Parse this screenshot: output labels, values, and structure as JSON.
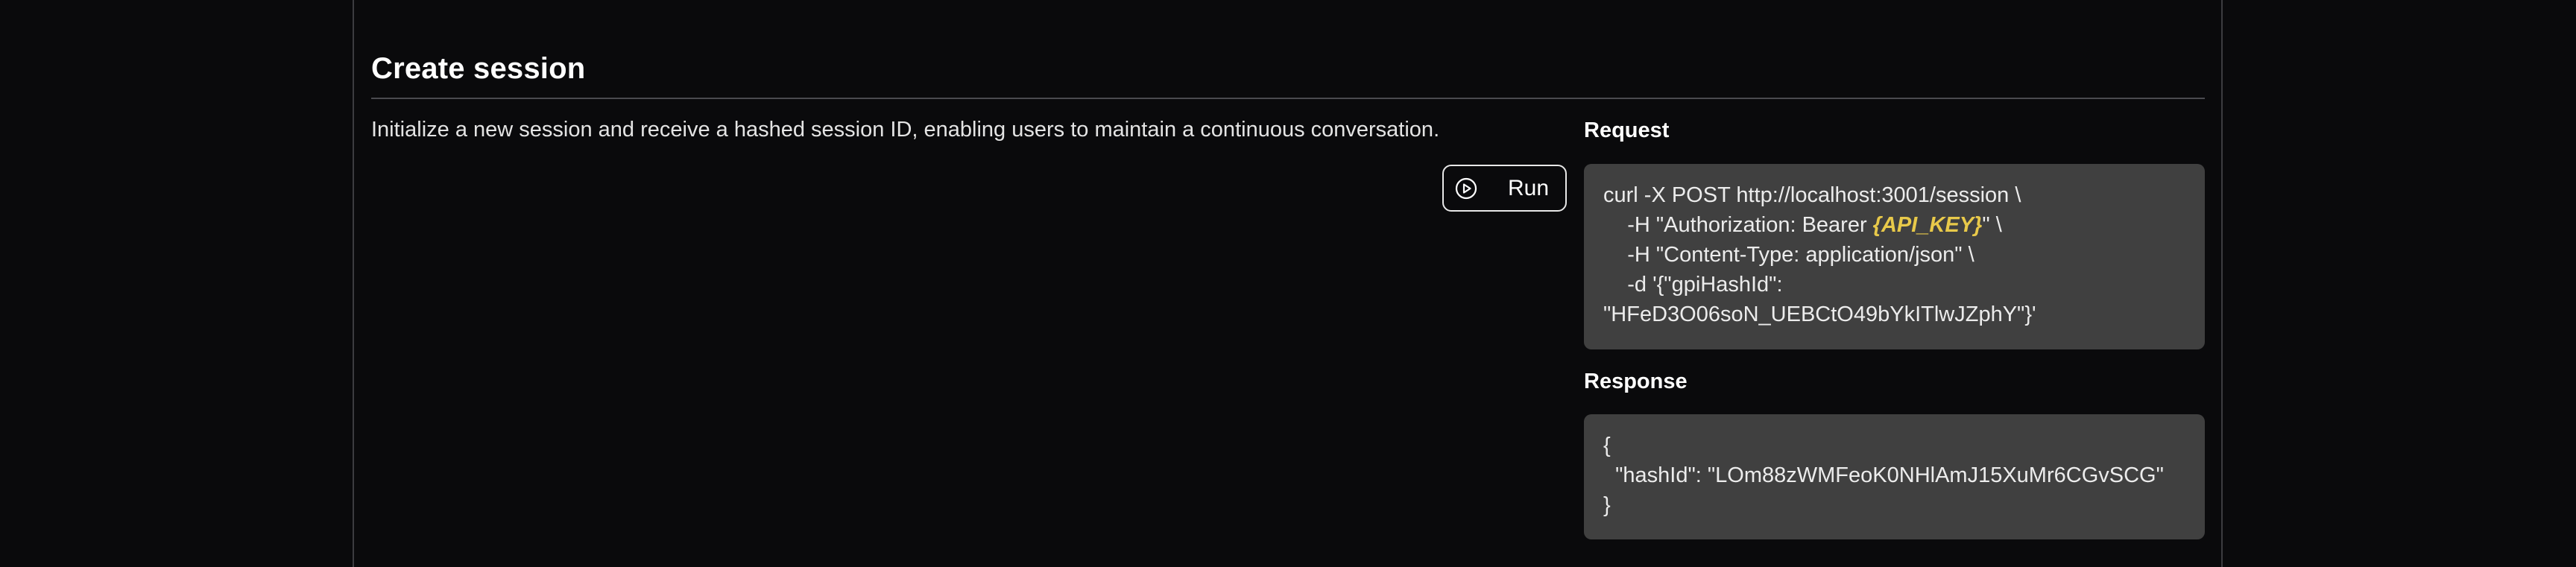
{
  "section": {
    "title": "Create session",
    "description": "Initialize a new session and receive a hashed session ID, enabling users to maintain a continuous conversation."
  },
  "run_button": {
    "label": "Run",
    "icon": "play-circle-icon"
  },
  "request": {
    "heading": "Request",
    "lines": {
      "l1": "curl -X POST http://localhost:3001/session \\",
      "l2_prefix": "    -H \"Authorization: Bearer ",
      "l2_key": "{API_KEY}",
      "l2_suffix": "\" \\",
      "l3": "    -H \"Content-Type: application/json\" \\",
      "l4": "    -d '{\"gpiHashId\":",
      "l5": "\"HFeD3O06soN_UEBCtO49bYkITlwJZphY\"}'"
    },
    "key_color": "#e8c94a"
  },
  "response": {
    "heading": "Response",
    "lines": {
      "l1": "{",
      "l2": "  \"hashId\": \"LOm88zWMFeoK0NHlAmJ15XuMr6CGvSCG\"",
      "l3": "}"
    }
  },
  "colors": {
    "background": "#0a0a0c",
    "code_background": "#404040",
    "divider": "#4a4a4f"
  }
}
